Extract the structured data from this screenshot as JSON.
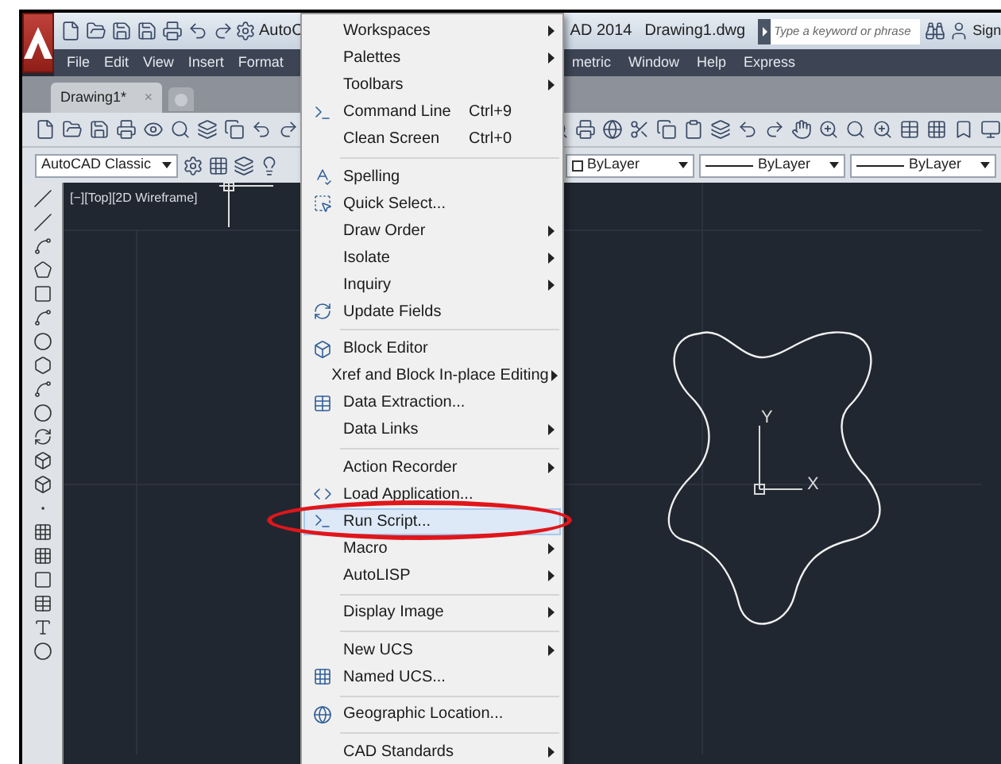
{
  "title_bar": {
    "workspace_text": "AutoC",
    "app_title": "AD 2014",
    "file_name": "Drawing1.dwg",
    "search": {
      "placeholder": "Type a keyword or phrase"
    },
    "sign_in": "Sign"
  },
  "menu_bar": {
    "left_items": [
      "File",
      "Edit",
      "View",
      "Insert",
      "Format"
    ],
    "right_items": [
      "metric",
      "Window",
      "Help",
      "Express"
    ]
  },
  "tabs": [
    {
      "label": "Drawing1*",
      "selected": true,
      "close": "×"
    }
  ],
  "workspace_dropdown": "AutoCAD Classic",
  "property_dropdowns": [
    {
      "kind": "color",
      "value": "ByLayer"
    },
    {
      "kind": "linetype",
      "value": "ByLayer"
    },
    {
      "kind": "linetype",
      "value": "ByLayer"
    }
  ],
  "viewport_label": "[−][Top][2D Wireframe]",
  "axes": {
    "x": "X",
    "y": "Y"
  },
  "menu": {
    "items": [
      {
        "kind": "item",
        "label": "Workspaces",
        "submenu": true,
        "has_icon": false,
        "selected": false
      },
      {
        "kind": "item",
        "label": "Palettes",
        "submenu": true,
        "has_icon": false,
        "selected": false
      },
      {
        "kind": "item",
        "label": "Toolbars",
        "submenu": true,
        "has_icon": false,
        "selected": false
      },
      {
        "kind": "item",
        "label": "Command Line",
        "shortcut": "Ctrl+9",
        "submenu": false,
        "has_icon": true,
        "selected": false
      },
      {
        "kind": "item",
        "label": "Clean Screen",
        "shortcut": "Ctrl+0",
        "submenu": false,
        "has_icon": false,
        "selected": false
      },
      {
        "kind": "separator"
      },
      {
        "kind": "item",
        "label": "Spelling",
        "submenu": false,
        "has_icon": true,
        "selected": false
      },
      {
        "kind": "item",
        "label": "Quick Select...",
        "submenu": false,
        "has_icon": true,
        "selected": false
      },
      {
        "kind": "item",
        "label": "Draw Order",
        "submenu": true,
        "has_icon": false,
        "selected": false
      },
      {
        "kind": "item",
        "label": "Isolate",
        "submenu": true,
        "has_icon": false,
        "selected": false
      },
      {
        "kind": "item",
        "label": "Inquiry",
        "submenu": true,
        "has_icon": false,
        "selected": false
      },
      {
        "kind": "item",
        "label": "Update Fields",
        "submenu": false,
        "has_icon": true,
        "selected": false
      },
      {
        "kind": "separator"
      },
      {
        "kind": "item",
        "label": "Block Editor",
        "submenu": false,
        "has_icon": true,
        "selected": false
      },
      {
        "kind": "item",
        "label": "Xref and Block In-place Editing",
        "submenu": true,
        "has_icon": false,
        "selected": false
      },
      {
        "kind": "item",
        "label": "Data Extraction...",
        "submenu": false,
        "has_icon": true,
        "selected": false
      },
      {
        "kind": "item",
        "label": "Data Links",
        "submenu": true,
        "has_icon": false,
        "selected": false
      },
      {
        "kind": "separator"
      },
      {
        "kind": "item",
        "label": "Action Recorder",
        "submenu": true,
        "has_icon": false,
        "selected": false
      },
      {
        "kind": "item",
        "label": "Load Application...",
        "submenu": false,
        "has_icon": true,
        "selected": false
      },
      {
        "kind": "item",
        "label": "Run Script...",
        "submenu": false,
        "has_icon": true,
        "selected": true
      },
      {
        "kind": "item",
        "label": "Macro",
        "submenu": true,
        "has_icon": false,
        "selected": false
      },
      {
        "kind": "item",
        "label": "AutoLISP",
        "submenu": true,
        "has_icon": false,
        "selected": false
      },
      {
        "kind": "separator"
      },
      {
        "kind": "item",
        "label": "Display Image",
        "submenu": true,
        "has_icon": false,
        "selected": false
      },
      {
        "kind": "separator"
      },
      {
        "kind": "item",
        "label": "New UCS",
        "submenu": true,
        "has_icon": false,
        "selected": false
      },
      {
        "kind": "item",
        "label": "Named UCS...",
        "submenu": false,
        "has_icon": true,
        "selected": false
      },
      {
        "kind": "separator"
      },
      {
        "kind": "item",
        "label": "Geographic Location...",
        "submenu": false,
        "has_icon": true,
        "selected": false
      },
      {
        "kind": "separator"
      },
      {
        "kind": "item",
        "label": "CAD Standards",
        "submenu": true,
        "has_icon": false,
        "selected": false
      }
    ]
  }
}
